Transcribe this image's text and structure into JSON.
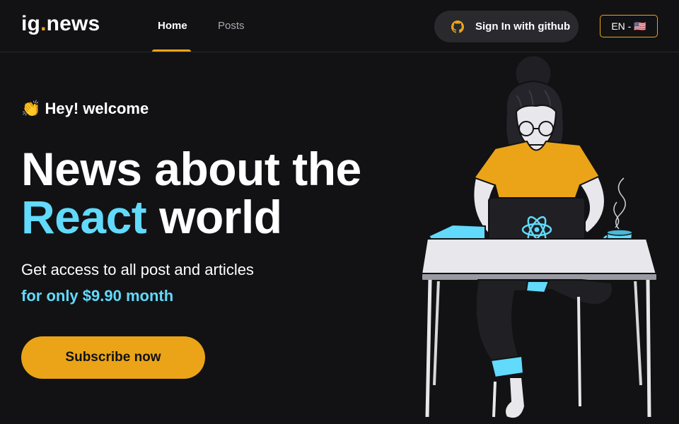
{
  "header": {
    "logo": {
      "text": "ig",
      "dot": ".",
      "suffix": "news"
    },
    "nav": [
      {
        "label": "Home",
        "active": true
      },
      {
        "label": "Posts",
        "active": false
      }
    ],
    "signin": {
      "label": "Sign In with github",
      "icon": "github-icon"
    },
    "language": "EN - 🇺🇸"
  },
  "hero": {
    "welcome": "👏 Hey! welcome",
    "headline_line1": "News about the",
    "headline_accent": "React",
    "headline_rest": " world",
    "subtitle": "Get access to all post and articles",
    "price": "for only $9.90 month",
    "subscribe_label": "Subscribe now"
  },
  "illustration": {
    "name": "woman-with-laptop",
    "icon": "react-logo-icon"
  },
  "colors": {
    "background": "#121214",
    "accent_yellow": "#eba417",
    "accent_cyan": "#61dafb",
    "header_border": "#29292e"
  }
}
